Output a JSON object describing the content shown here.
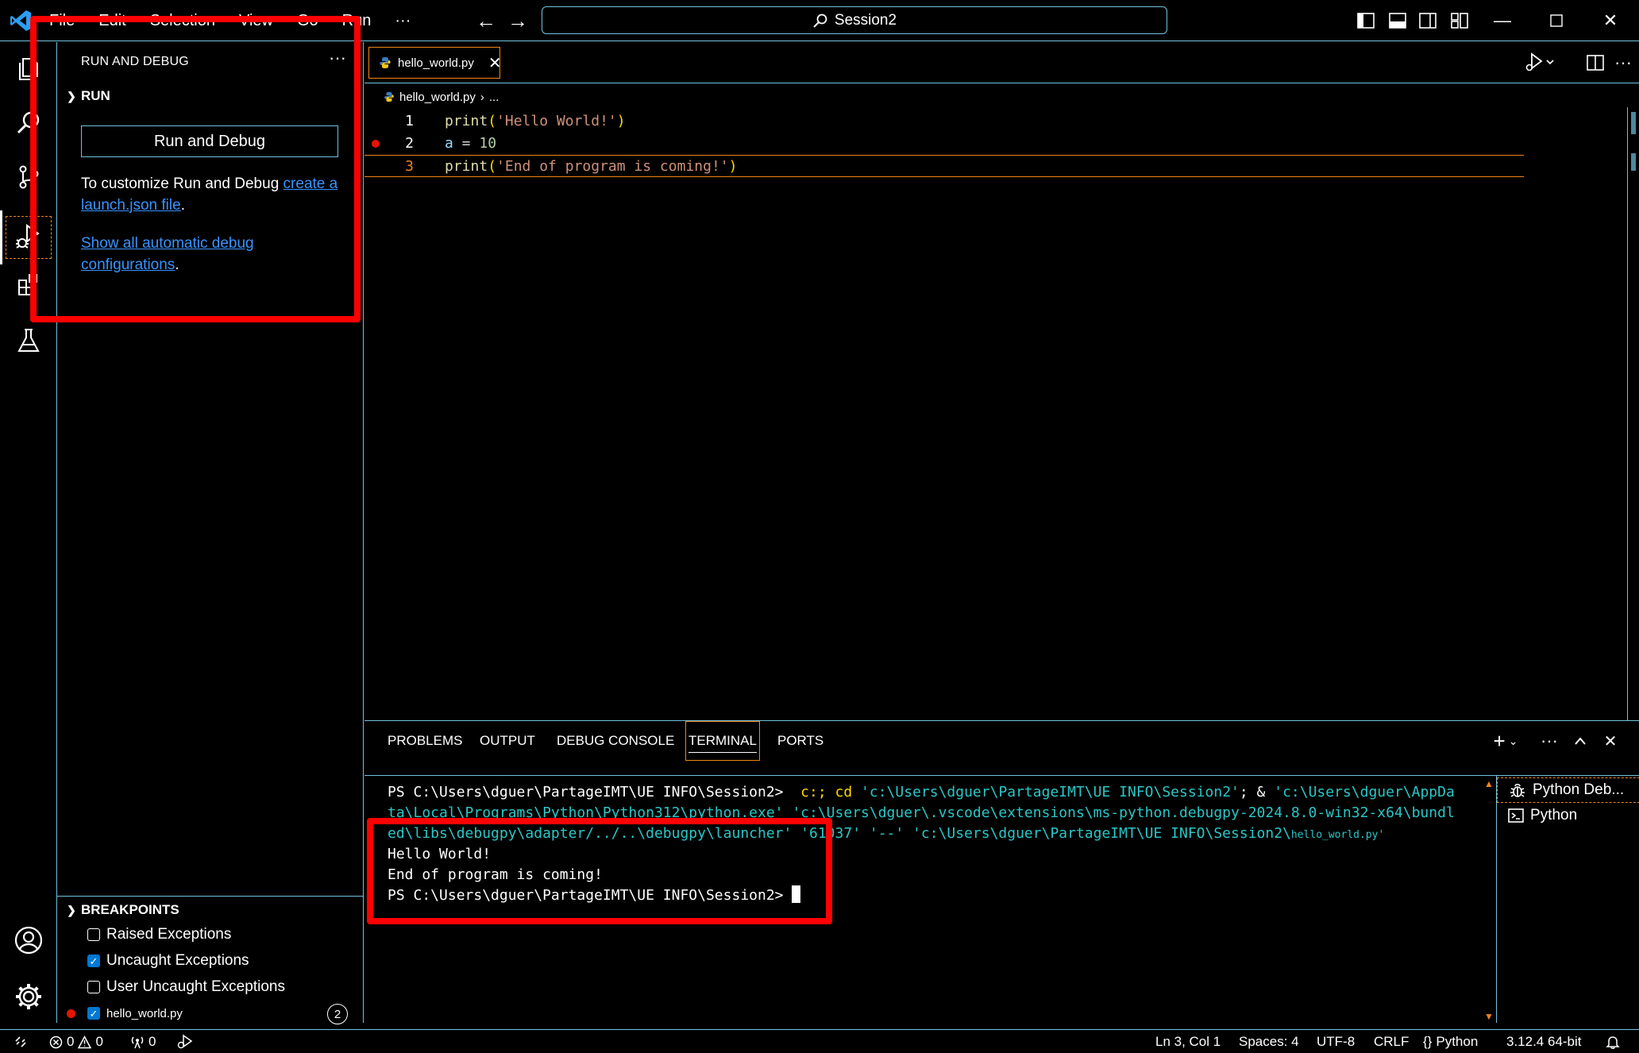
{
  "titlebar": {
    "menu": [
      "File",
      "Edit",
      "Selection",
      "View",
      "Go",
      "Run"
    ],
    "more_label": "···",
    "search_text": "Session2"
  },
  "activitybar": {
    "items": [
      "explorer",
      "search",
      "source-control",
      "run-and-debug",
      "extensions",
      "testing"
    ],
    "active": "run-and-debug"
  },
  "sidebar": {
    "title": "RUN AND DEBUG",
    "more_label": "···",
    "run_section": "RUN",
    "run_button": "Run and Debug",
    "customize_text": "To customize Run and Debug ",
    "customize_link": "create a launch.json file",
    "customize_end": ".",
    "show_link": "Show all automatic debug configurations",
    "show_end": ".",
    "breakpoints_section": "BREAKPOINTS",
    "breakpoints": [
      {
        "label": "Raised Exceptions",
        "checked": false
      },
      {
        "label": "Uncaught Exceptions",
        "checked": true
      },
      {
        "label": "User Uncaught Exceptions",
        "checked": false
      },
      {
        "label": "hello_world.py",
        "checked": true
      }
    ],
    "breakpoint_count": "2"
  },
  "editor": {
    "tab_label": "hello_world.py",
    "breadcrumb_file": "hello_world.py",
    "breadcrumb_more": "...",
    "lines": [
      {
        "num": "1",
        "tokens": [
          [
            "fn",
            "print"
          ],
          [
            "punc",
            "("
          ],
          [
            "str",
            "'Hello World!'"
          ],
          [
            "punc",
            ")"
          ]
        ]
      },
      {
        "num": "2",
        "tokens": [
          [
            "var",
            "a"
          ],
          [
            "op",
            " = "
          ],
          [
            "num",
            "10"
          ]
        ]
      },
      {
        "num": "3",
        "tokens": [
          [
            "fn",
            "print"
          ],
          [
            "punc",
            "("
          ],
          [
            "str",
            "'End of program is coming!'"
          ],
          [
            "punc",
            ")"
          ]
        ]
      }
    ],
    "breakpoint_line": 2,
    "current_line": 3
  },
  "panel": {
    "tabs": [
      "PROBLEMS",
      "OUTPUT",
      "DEBUG CONSOLE",
      "TERMINAL",
      "PORTS"
    ],
    "active_tab": "TERMINAL",
    "terminal": {
      "line1_prompt": "PS C:\\Users\\dguer\\PartageIMT\\UE INFO\\Session2> ",
      "line1_cmd": " c:; cd ",
      "line1_path1": "'c:\\Users\\dguer\\PartageIMT\\UE INFO\\Session2'",
      "line1_amp": "; & ",
      "line1_path2": "'c:\\Users\\dguer\\AppDa",
      "line2": "ta\\Local\\Programs\\Python\\Python312\\python.exe' 'c:\\Users\\dguer\\.vscode\\extensions\\ms-python.debugpy-2024.8.0-win32-x64\\bundl",
      "line3": "ed\\libs\\debugpy\\adapter/../..\\debugpy\\launcher' '61037' '--' 'c:\\Users\\dguer\\PartageIMT\\UE INFO\\Session2\\",
      "line3_tiny": "hello_world.py'",
      "out1": "Hello World!",
      "out2": "End of program is coming!",
      "prompt": "PS C:\\Users\\dguer\\PartageIMT\\UE INFO\\Session2> "
    },
    "terminal_list": [
      "Python Deb...",
      "Python"
    ]
  },
  "statusbar": {
    "errors": "0",
    "warnings": "0",
    "ports": "0",
    "position": "Ln 3, Col 1",
    "spaces": "Spaces: 4",
    "encoding": "UTF-8",
    "eol": "CRLF",
    "language": "Python",
    "interpreter": "3.12.4 64-bit"
  },
  "colors": {
    "border": "#6fc3df",
    "focus": "#f38518",
    "link": "#3794ff",
    "highlight": "#ff0000",
    "breakpoint": "#e51400"
  }
}
